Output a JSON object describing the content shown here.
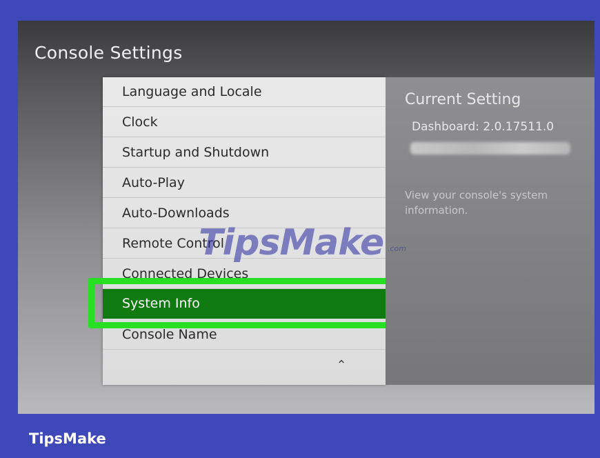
{
  "header": {
    "title": "Console Settings"
  },
  "menu": {
    "items": [
      {
        "label": "Language and Locale",
        "selected": false
      },
      {
        "label": "Clock",
        "selected": false
      },
      {
        "label": "Startup and Shutdown",
        "selected": false
      },
      {
        "label": "Auto-Play",
        "selected": false
      },
      {
        "label": "Auto-Downloads",
        "selected": false
      },
      {
        "label": "Remote Control",
        "selected": false
      },
      {
        "label": "Connected Devices",
        "selected": false
      },
      {
        "label": "System Info",
        "selected": true
      },
      {
        "label": "Console Name",
        "selected": false
      }
    ],
    "scroll_up_icon": "caret-up-icon"
  },
  "info": {
    "heading": "Current Setting",
    "version": "Dashboard: 2.0.17511.0",
    "description": "View your console's system information."
  },
  "watermark": {
    "text": "TipsMake",
    "suffix": ".com"
  },
  "footer": {
    "brand": "TipsMake"
  },
  "colors": {
    "frame": "#3f48b8",
    "selected_item": "#0f7a10",
    "highlight_border": "#27e023"
  }
}
